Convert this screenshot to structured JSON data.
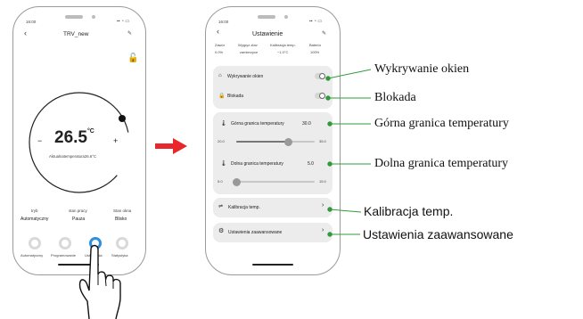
{
  "left_phone": {
    "status_time": "16:00",
    "title": "TRV_new",
    "temperature": "26.5",
    "temp_unit": "°C",
    "current_temp": "Aktualnatemperatura26.6°C",
    "minus": "−",
    "plus": "+",
    "modes": [
      {
        "caption": "tryb",
        "value": "Automatyczny"
      },
      {
        "caption": "stan pracy",
        "value": "Pauza"
      },
      {
        "caption": "Stan okna",
        "value": "Blisko"
      }
    ],
    "nav": [
      "Automatyczny",
      "Programowanie",
      "Ustawienia",
      "Statystyka"
    ]
  },
  "right_phone": {
    "status_time": "16:00",
    "title": "Ustawienie",
    "info": [
      {
        "label": "Zawór",
        "value": "0.0%"
      },
      {
        "label": "Wygryz ztav",
        "value": "zamierzyce"
      },
      {
        "label": "Kalibracja temp.",
        "value": "−1.0°C"
      },
      {
        "label": "Bateria",
        "value": "100%"
      }
    ],
    "window_detection": "Wykrywanie okien",
    "lock": "Blokada",
    "upper_limit": {
      "label": "Górna granica temperatury",
      "value": "30.0",
      "min": "20.0",
      "max": "35.0",
      "fraction": 0.67
    },
    "lower_limit": {
      "label": "Dolna granica temperatury",
      "value": "5.0",
      "min": "5.0",
      "max": "15.0",
      "fraction": 0.0
    },
    "calibration": "Kalibracja temp.",
    "advanced": "Ustawienia zaawansowane"
  },
  "callouts": {
    "window": "Wykrywanie okien",
    "lock": "Blokada",
    "upper": "Górna granica temperatury",
    "lower": "Dolna granica temperatury",
    "calibration": "Kalibracja temp.",
    "advanced": "Ustawienia zaawansowane"
  },
  "colors": {
    "arrow": "#e8262b",
    "callout_line": "#2f9a3a",
    "callout_dot": "#2f9a3a"
  }
}
